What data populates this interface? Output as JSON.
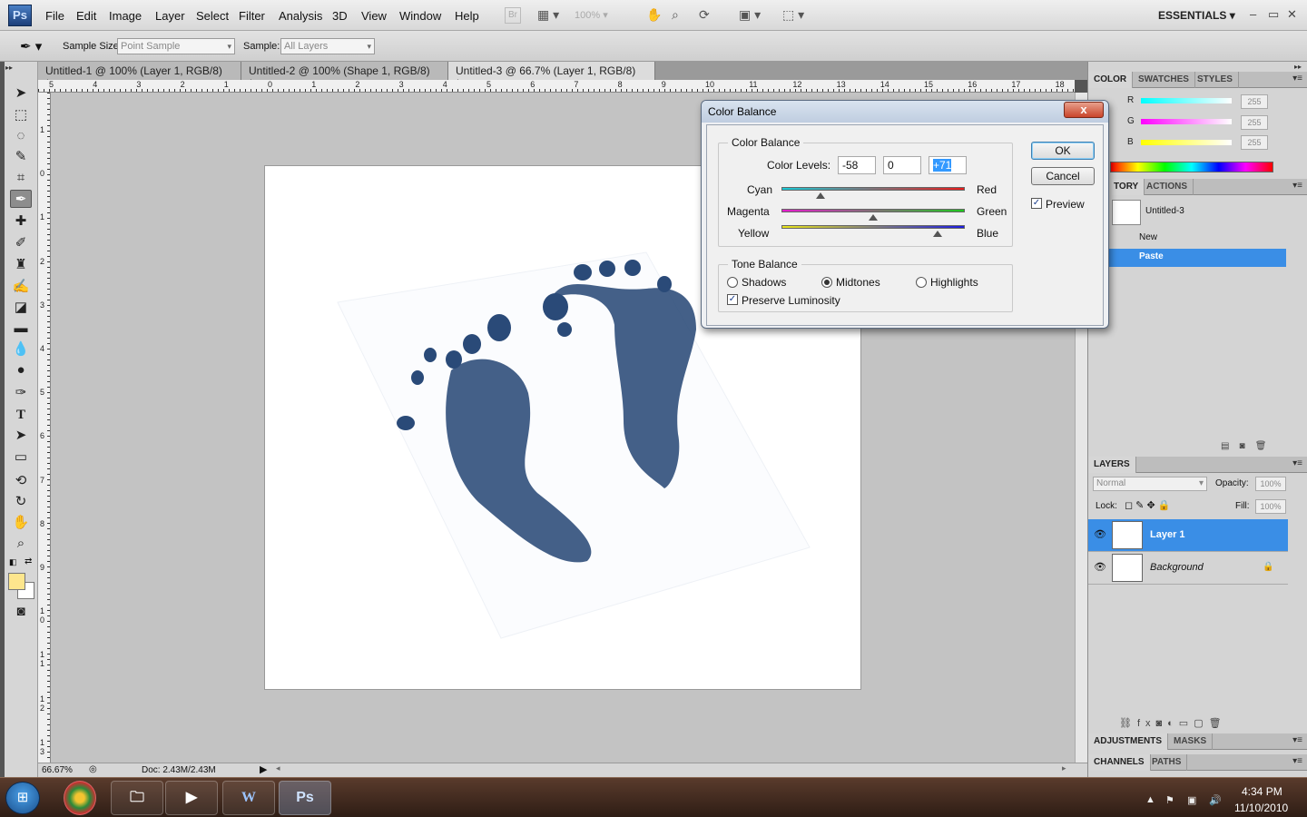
{
  "menubar": {
    "logo": "Ps",
    "items": [
      "File",
      "Edit",
      "Image",
      "Layer",
      "Select",
      "Filter",
      "Analysis",
      "3D",
      "View",
      "Window",
      "Help"
    ],
    "bridge_button": "Br",
    "zoom_level": "100%",
    "workspace": "ESSENTIALS"
  },
  "options": {
    "sample_size_label": "Sample Size:",
    "sample_size_value": "Point Sample",
    "sample_label": "Sample:",
    "sample_value": "All Layers"
  },
  "tabs": [
    {
      "label": "Untitled-1 @ 100% (Layer 1, RGB/8) *"
    },
    {
      "label": "Untitled-2 @ 100% (Shape 1, RGB/8) *"
    },
    {
      "label": "Untitled-3 @ 66.7% (Layer 1, RGB/8) *"
    }
  ],
  "ruler_h": [
    "5",
    "4",
    "3",
    "2",
    "1",
    "0",
    "1",
    "2",
    "3",
    "4",
    "5",
    "6",
    "7",
    "8",
    "9",
    "10",
    "11",
    "12",
    "13",
    "14",
    "15",
    "16",
    "17",
    "18"
  ],
  "ruler_v": [
    "1",
    "0",
    "1",
    "2",
    "3",
    "4",
    "5",
    "6",
    "7",
    "8",
    "9",
    "1 0",
    "1 1",
    "1 2",
    "1 3"
  ],
  "status": {
    "zoom": "66.67%",
    "doc": "Doc: 2.43M/2.43M"
  },
  "color_panel": {
    "tabs": [
      "COLOR",
      "SWATCHES",
      "STYLES"
    ],
    "channels": [
      {
        "label": "R",
        "value": "255"
      },
      {
        "label": "G",
        "value": "255"
      },
      {
        "label": "B",
        "value": "255"
      }
    ]
  },
  "history_panel": {
    "tabs": [
      "TORY",
      "ACTIONS"
    ],
    "snapshot": "Untitled-3",
    "items": [
      "New",
      "Paste"
    ]
  },
  "layers_panel": {
    "tab": "LAYERS",
    "blend_mode": "Normal",
    "opacity_label": "Opacity:",
    "opacity_value": "100%",
    "lock_label": "Lock:",
    "fill_label": "Fill:",
    "fill_value": "100%",
    "layers": [
      {
        "name": "Layer 1"
      },
      {
        "name": "Background"
      }
    ]
  },
  "adjustments_tabs": [
    "ADJUSTMENTS",
    "MASKS"
  ],
  "channels_tabs": [
    "CHANNELS",
    "PATHS"
  ],
  "dialog": {
    "title": "Color Balance",
    "close": "x",
    "color_balance_group": "Color Balance",
    "color_levels_label": "Color Levels:",
    "levels": [
      "-58",
      "0",
      "+71"
    ],
    "sliders": [
      {
        "left": "Cyan",
        "right": "Red",
        "value": -58,
        "left_color": "#19c9d6",
        "right_color": "#e81c1c"
      },
      {
        "left": "Magenta",
        "right": "Green",
        "value": 0,
        "left_color": "#e51ccd",
        "right_color": "#1fc71f"
      },
      {
        "left": "Yellow",
        "right": "Blue",
        "value": 71,
        "left_color": "#e9e41a",
        "right_color": "#1c1ce0"
      }
    ],
    "tone_group": "Tone Balance",
    "tones": [
      "Shadows",
      "Midtones",
      "Highlights"
    ],
    "selected_tone": "Midtones",
    "preserve_luminosity": "Preserve Luminosity",
    "ok": "OK",
    "cancel": "Cancel",
    "preview": "Preview"
  },
  "taskbar": {
    "ps_label": "Ps",
    "time": "4:34 PM",
    "date": "11/10/2010"
  }
}
